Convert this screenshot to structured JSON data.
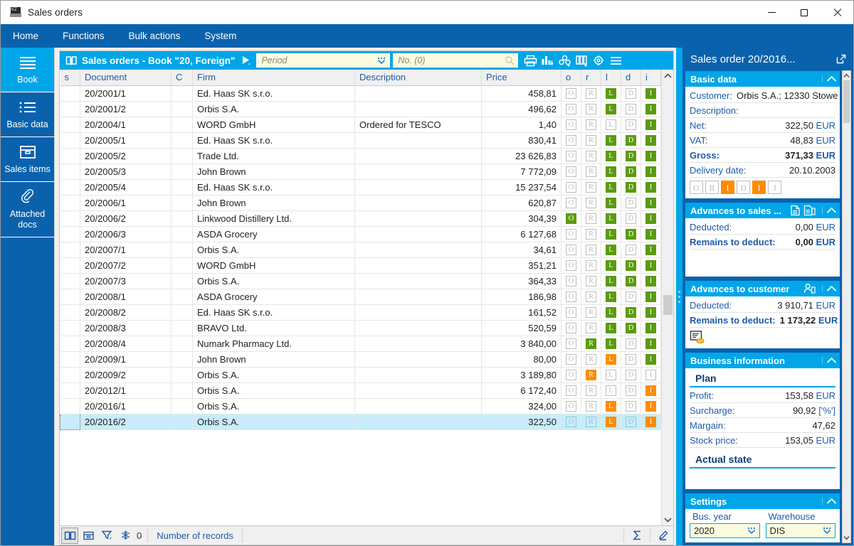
{
  "window": {
    "title": "Sales orders",
    "icon": "app-icon",
    "minimize": "minimize",
    "maximize": "maximize",
    "close": "close"
  },
  "menubar": {
    "items": [
      {
        "label": "Home"
      },
      {
        "label": "Functions"
      },
      {
        "label": "Bulk actions"
      },
      {
        "label": "System"
      }
    ]
  },
  "sidebar": {
    "items": [
      {
        "label": "Book",
        "icon": "list-lines-icon",
        "active": true
      },
      {
        "label": "Basic data",
        "icon": "bulleted-list-icon",
        "active": false
      },
      {
        "label": "Sales items",
        "icon": "box-icon",
        "active": false
      },
      {
        "label": "Attached docs",
        "icon": "paperclip-icon",
        "active": false
      }
    ]
  },
  "book": {
    "header_prefix": "Sales orders",
    "header_sep": " - ",
    "header_book": "Book \"20, Foreign\"",
    "period_placeholder": "Period",
    "no_placeholder": "No. (0)",
    "tools": [
      {
        "name": "print-icon"
      },
      {
        "name": "chart-icon"
      },
      {
        "name": "cluster-icon"
      },
      {
        "name": "columns-icon"
      },
      {
        "name": "gear-icon"
      },
      {
        "name": "menu-icon"
      }
    ]
  },
  "table": {
    "columns": [
      {
        "key": "s",
        "label": "s",
        "align": "left"
      },
      {
        "key": "document",
        "label": "Document",
        "align": "left"
      },
      {
        "key": "c",
        "label": "C",
        "align": "left"
      },
      {
        "key": "firm",
        "label": "Firm",
        "align": "left"
      },
      {
        "key": "description",
        "label": "Description",
        "align": "left"
      },
      {
        "key": "price",
        "label": "Price",
        "align": "right"
      },
      {
        "key": "o",
        "label": "o",
        "align": "center"
      },
      {
        "key": "r",
        "label": "r",
        "align": "center"
      },
      {
        "key": "l",
        "label": "l",
        "align": "center"
      },
      {
        "key": "d",
        "label": "d",
        "align": "center"
      },
      {
        "key": "i",
        "label": "i",
        "align": "center"
      }
    ],
    "rows": [
      {
        "document": "20/2001/1",
        "c": "",
        "firm": "Ed. Haas SK s.r.o.",
        "description": "",
        "price": "458,81",
        "flags": {
          "o": "off",
          "r": "off",
          "l": "green",
          "d": "off",
          "i": "green"
        },
        "selected": false
      },
      {
        "document": "20/2001/2",
        "c": "",
        "firm": "Orbis S.A.",
        "description": "",
        "price": "496,62",
        "flags": {
          "o": "off",
          "r": "off",
          "l": "green",
          "d": "off",
          "i": "green"
        },
        "selected": false
      },
      {
        "document": "20/2004/1",
        "c": "",
        "firm": "WORD GmbH",
        "description": "Ordered for TESCO",
        "price": "1,40",
        "flags": {
          "o": "off",
          "r": "off",
          "l": "off",
          "d": "off",
          "i": "green"
        },
        "selected": false
      },
      {
        "document": "20/2005/1",
        "c": "",
        "firm": "Ed. Haas SK s.r.o.",
        "description": "",
        "price": "830,41",
        "flags": {
          "o": "off",
          "r": "off",
          "l": "green",
          "d": "green",
          "i": "green"
        },
        "selected": false
      },
      {
        "document": "20/2005/2",
        "c": "",
        "firm": "Trade Ltd.",
        "description": "",
        "price": "23 626,83",
        "flags": {
          "o": "off",
          "r": "off",
          "l": "green",
          "d": "green",
          "i": "green"
        },
        "selected": false
      },
      {
        "document": "20/2005/3",
        "c": "",
        "firm": "John Brown",
        "description": "",
        "price": "7 772,09",
        "flags": {
          "o": "off",
          "r": "off",
          "l": "green",
          "d": "green",
          "i": "green"
        },
        "selected": false
      },
      {
        "document": "20/2005/4",
        "c": "",
        "firm": "Ed. Haas SK s.r.o.",
        "description": "",
        "price": "15 237,54",
        "flags": {
          "o": "off",
          "r": "off",
          "l": "green",
          "d": "green",
          "i": "green"
        },
        "selected": false
      },
      {
        "document": "20/2006/1",
        "c": "",
        "firm": "John Brown",
        "description": "",
        "price": "620,87",
        "flags": {
          "o": "off",
          "r": "off",
          "l": "green",
          "d": "off",
          "i": "green"
        },
        "selected": false
      },
      {
        "document": "20/2006/2",
        "c": "",
        "firm": "Linkwood Distillery Ltd.",
        "description": "",
        "price": "304,39",
        "flags": {
          "o": "green",
          "r": "off",
          "l": "green",
          "d": "off",
          "i": "green"
        },
        "selected": false
      },
      {
        "document": "20/2006/3",
        "c": "",
        "firm": "ASDA Grocery",
        "description": "",
        "price": "6 127,68",
        "flags": {
          "o": "off",
          "r": "off",
          "l": "green",
          "d": "green",
          "i": "green"
        },
        "selected": false
      },
      {
        "document": "20/2007/1",
        "c": "",
        "firm": "Orbis S.A.",
        "description": "",
        "price": "34,61",
        "flags": {
          "o": "off",
          "r": "off",
          "l": "green",
          "d": "off",
          "i": "green"
        },
        "selected": false
      },
      {
        "document": "20/2007/2",
        "c": "",
        "firm": "WORD GmbH",
        "description": "",
        "price": "351,21",
        "flags": {
          "o": "off",
          "r": "off",
          "l": "green",
          "d": "green",
          "i": "green"
        },
        "selected": false
      },
      {
        "document": "20/2007/3",
        "c": "",
        "firm": "Orbis S.A.",
        "description": "",
        "price": "364,33",
        "flags": {
          "o": "off",
          "r": "off",
          "l": "green",
          "d": "green",
          "i": "green"
        },
        "selected": false
      },
      {
        "document": "20/2008/1",
        "c": "",
        "firm": "ASDA Grocery",
        "description": "",
        "price": "186,98",
        "flags": {
          "o": "off",
          "r": "off",
          "l": "green",
          "d": "off",
          "i": "green"
        },
        "selected": false
      },
      {
        "document": "20/2008/2",
        "c": "",
        "firm": "Ed. Haas SK s.r.o.",
        "description": "",
        "price": "161,52",
        "flags": {
          "o": "off",
          "r": "off",
          "l": "green",
          "d": "green",
          "i": "green"
        },
        "selected": false
      },
      {
        "document": "20/2008/3",
        "c": "",
        "firm": "BRAVO Ltd.",
        "description": "",
        "price": "520,59",
        "flags": {
          "o": "off",
          "r": "off",
          "l": "green",
          "d": "green",
          "i": "green"
        },
        "selected": false
      },
      {
        "document": "20/2008/4",
        "c": "",
        "firm": "Numark Pharmacy Ltd.",
        "description": "",
        "price": "3 840,00",
        "flags": {
          "o": "off",
          "r": "green",
          "l": "green",
          "d": "off",
          "i": "green"
        },
        "selected": false
      },
      {
        "document": "20/2009/1",
        "c": "",
        "firm": "John Brown",
        "description": "",
        "price": "80,00",
        "flags": {
          "o": "off",
          "r": "off",
          "l": "orange",
          "d": "off",
          "i": "green"
        },
        "selected": false
      },
      {
        "document": "20/2009/2",
        "c": "",
        "firm": "Orbis S.A.",
        "description": "",
        "price": "3 189,80",
        "flags": {
          "o": "off",
          "r": "orange",
          "l": "off",
          "d": "off",
          "i": "off"
        },
        "selected": false
      },
      {
        "document": "20/2012/1",
        "c": "",
        "firm": "Orbis S.A.",
        "description": "",
        "price": "6 172,40",
        "flags": {
          "o": "off",
          "r": "off",
          "l": "off",
          "d": "off",
          "i": "orange"
        },
        "selected": false
      },
      {
        "document": "20/2016/1",
        "c": "",
        "firm": "Orbis S.A.",
        "description": "",
        "price": "324,00",
        "flags": {
          "o": "off",
          "r": "off",
          "l": "orange",
          "d": "off",
          "i": "orange"
        },
        "selected": false
      },
      {
        "document": "20/2016/2",
        "c": "",
        "firm": "Orbis S.A.",
        "description": "",
        "price": "322,50",
        "flags": {
          "o": "off",
          "r": "off",
          "l": "orange",
          "d": "off",
          "i": "orange"
        },
        "selected": true
      }
    ]
  },
  "gridfooter": {
    "buttons": [
      {
        "name": "book-view-button",
        "icon": "open-book-icon",
        "active": true
      },
      {
        "name": "card-view-button",
        "icon": "card-icon",
        "active": false
      },
      {
        "name": "filter-button",
        "icon": "funnel-icon",
        "active": false
      },
      {
        "name": "snowflake-button",
        "icon": "snowflake-icon",
        "active": false
      }
    ],
    "count": "0",
    "records_label": "Number of records",
    "sum_icon": "sigma-icon",
    "edit_icon": "pencil-icon"
  },
  "detail": {
    "title": "Sales order 20/2016...",
    "popout_icon": "popout-icon",
    "cards": [
      {
        "id": "basic-data",
        "title": "Basic data",
        "icons": [],
        "rows": [
          {
            "key": "Customer:",
            "value": "Orbis S.A.; 12330 Stowe ...",
            "currency": "",
            "bold": false
          },
          {
            "key": "Description:",
            "value": "",
            "currency": "",
            "bold": false
          },
          {
            "key": "Net:",
            "value": "322,50",
            "currency": "EUR",
            "bold": false
          },
          {
            "key": "VAT:",
            "value": "48,83",
            "currency": "EUR",
            "bold": false
          },
          {
            "key": "Gross:",
            "value": "371,33",
            "currency": "EUR",
            "bold": true
          },
          {
            "key": "Delivery date:",
            "value": "20.10.2003",
            "currency": "",
            "bold": false
          }
        ],
        "badges": [
          {
            "label": "O",
            "state": "off"
          },
          {
            "label": "R",
            "state": "off"
          },
          {
            "label": "I",
            "state": "orange"
          },
          {
            "label": "D",
            "state": "off"
          },
          {
            "label": "I",
            "state": "orange"
          },
          {
            "label": "J",
            "state": "off"
          }
        ]
      },
      {
        "id": "advances-to-sales",
        "title": "Advances to sales ...",
        "icons": [
          "doc-single-icon",
          "doc-multi-icon"
        ],
        "rows": [
          {
            "key": "Deducted:",
            "value": "0,00",
            "currency": "EUR",
            "bold": false
          },
          {
            "key": "Remains to deduct:",
            "value": "0,00",
            "currency": "EUR",
            "bold": true
          }
        ],
        "badges": []
      },
      {
        "id": "advances-to-customer",
        "title": "Advances to customer",
        "icons": [
          "person-doc-icon"
        ],
        "rows": [
          {
            "key": "Deducted:",
            "value": "3 910,71",
            "currency": "EUR",
            "bold": false
          },
          {
            "key": "Remains to deduct:",
            "value": "1 173,22",
            "currency": "EUR",
            "bold": true
          }
        ],
        "badges": [],
        "footer_icon": "invoice-coin-icon"
      },
      {
        "id": "business-information",
        "title": "Business information",
        "icons": [],
        "section_plan": "Plan",
        "rows": [
          {
            "key": "Profit:",
            "value": "153,58",
            "currency": "EUR",
            "bold": false
          },
          {
            "key": "Surcharge:",
            "value": "90,92",
            "currency": "['%']",
            "bold": false
          },
          {
            "key": "Margain:",
            "value": "47,62",
            "currency": "",
            "bold": false
          },
          {
            "key": "Stock price:",
            "value": "153,05",
            "currency": "EUR",
            "bold": false
          }
        ],
        "section_actual": "Actual state",
        "badges": []
      }
    ],
    "settings": {
      "title": "Settings",
      "fields": [
        {
          "label": "Bus. year",
          "value": "2020",
          "name": "bus-year-select"
        },
        {
          "label": "Warehouse",
          "value": "DIS",
          "name": "warehouse-select"
        }
      ]
    }
  },
  "colors": {
    "menu_blue": "#0a62ad",
    "accent_cyan": "#00a6e8",
    "green_badge": "#5b9b0e",
    "orange_badge": "#ff8c00",
    "selection": "#c9ecfa",
    "field_yellow": "#fbfbdf",
    "link_blue": "#1e5aa8"
  }
}
